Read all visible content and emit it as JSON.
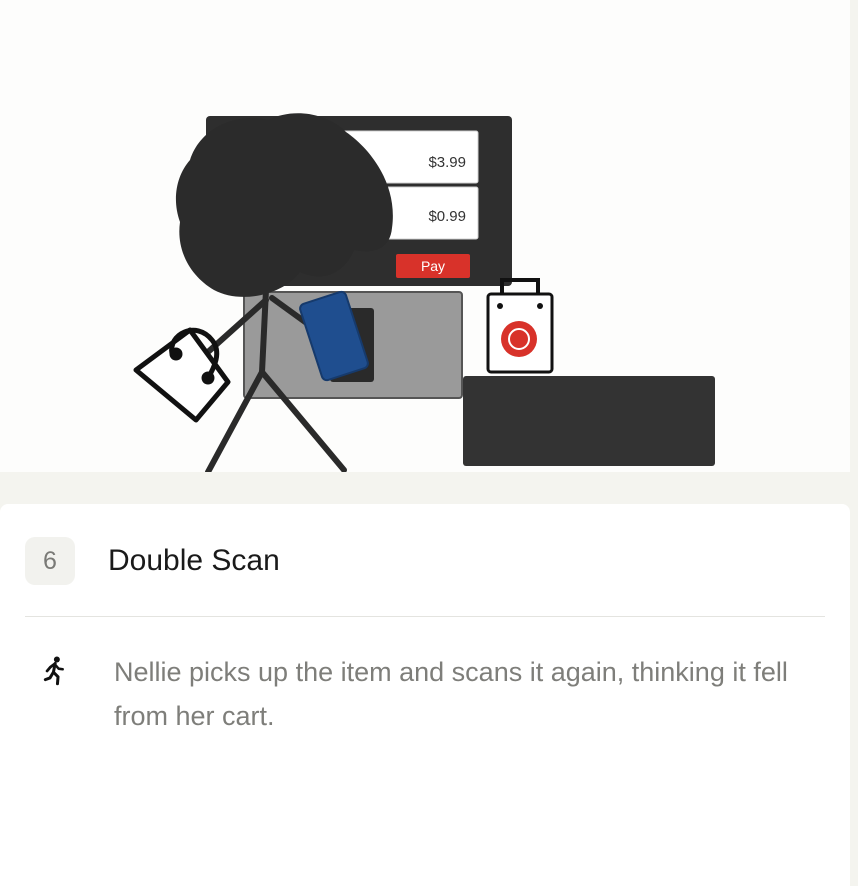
{
  "illustration": {
    "screen_items": [
      {
        "price": "$3.99"
      },
      {
        "price": "$0.99"
      }
    ],
    "pay_label": "Pay",
    "colors": {
      "screen": "#2e2e2e",
      "pay_button": "#d8322a",
      "scanner": "#9a9a9a",
      "item": "#1f4e8f",
      "bag_logo": "#d8322a",
      "counter": "#333333"
    }
  },
  "step": {
    "number": "6",
    "title": "Double Scan"
  },
  "action": {
    "icon": "walking-person-icon",
    "text": "Nellie picks up the item and scans it again, thinking it fell from her cart."
  }
}
